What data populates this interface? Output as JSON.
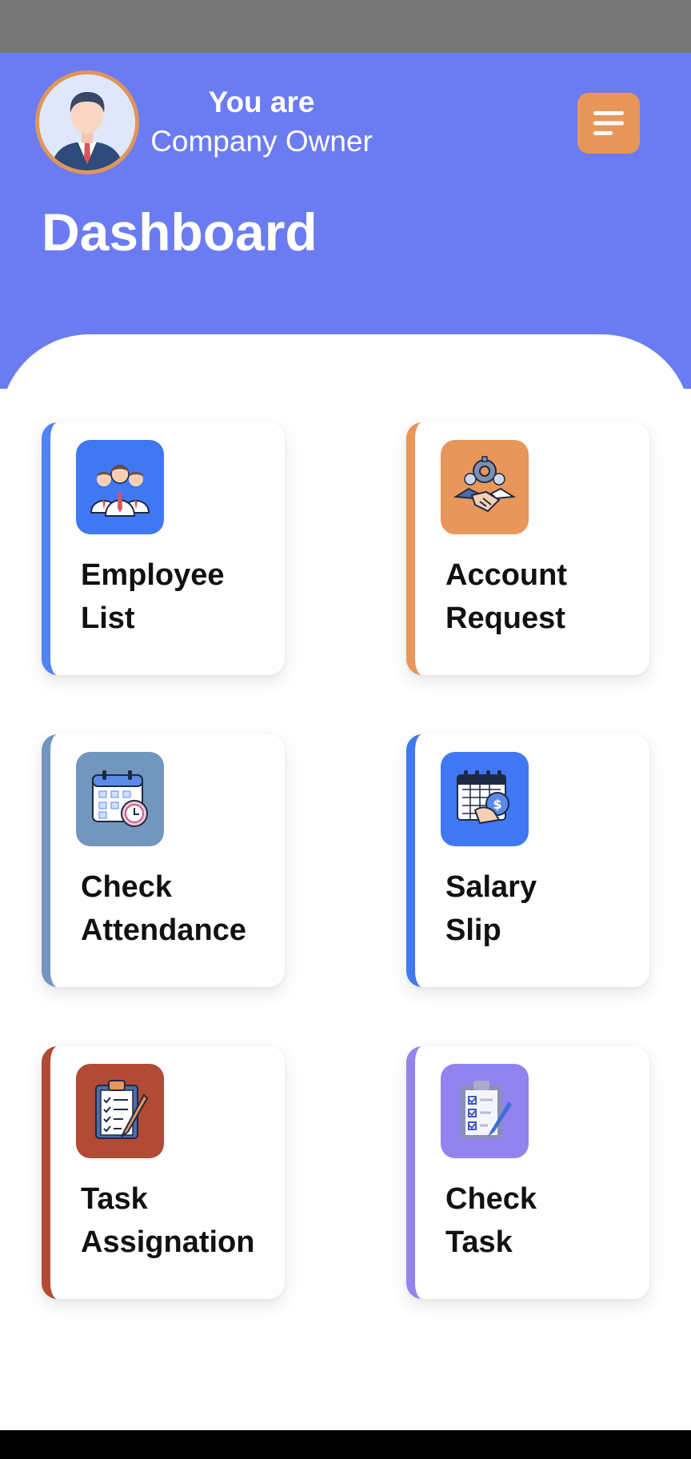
{
  "header": {
    "role_prefix": "You are",
    "role_name": "Company Owner",
    "title": "Dashboard",
    "avatar_icon": "businessman-avatar-icon",
    "menu_icon": "menu-lines-icon"
  },
  "colors": {
    "header_bg": "#6b7cf2",
    "menu_button": "#e8965a",
    "avatar_ring": "#e0955a"
  },
  "cards": [
    {
      "line1": "Employee",
      "line2": "List",
      "icon": "team-icon",
      "accent": "#4f84f2",
      "icon_bg": "#3f78f2"
    },
    {
      "line1": "Account",
      "line2": "Request",
      "icon": "handshake-gear-icon",
      "accent": "#e8965a",
      "icon_bg": "#e8965a"
    },
    {
      "line1": "Check",
      "line2": "Attendance",
      "icon": "calendar-clock-icon",
      "accent": "#7296bd",
      "icon_bg": "#7296bd"
    },
    {
      "line1": "Salary",
      "line2": "Slip",
      "icon": "salary-calendar-icon",
      "accent": "#3f78f2",
      "icon_bg": "#3f78f2"
    },
    {
      "line1": "Task",
      "line2": "Assignation",
      "icon": "clipboard-pencil-icon",
      "accent": "#b34a35",
      "icon_bg": "#b34a35"
    },
    {
      "line1": "Check",
      "line2": "Task",
      "icon": "checklist-icon",
      "accent": "#9283ef",
      "icon_bg": "#9283ef"
    }
  ]
}
